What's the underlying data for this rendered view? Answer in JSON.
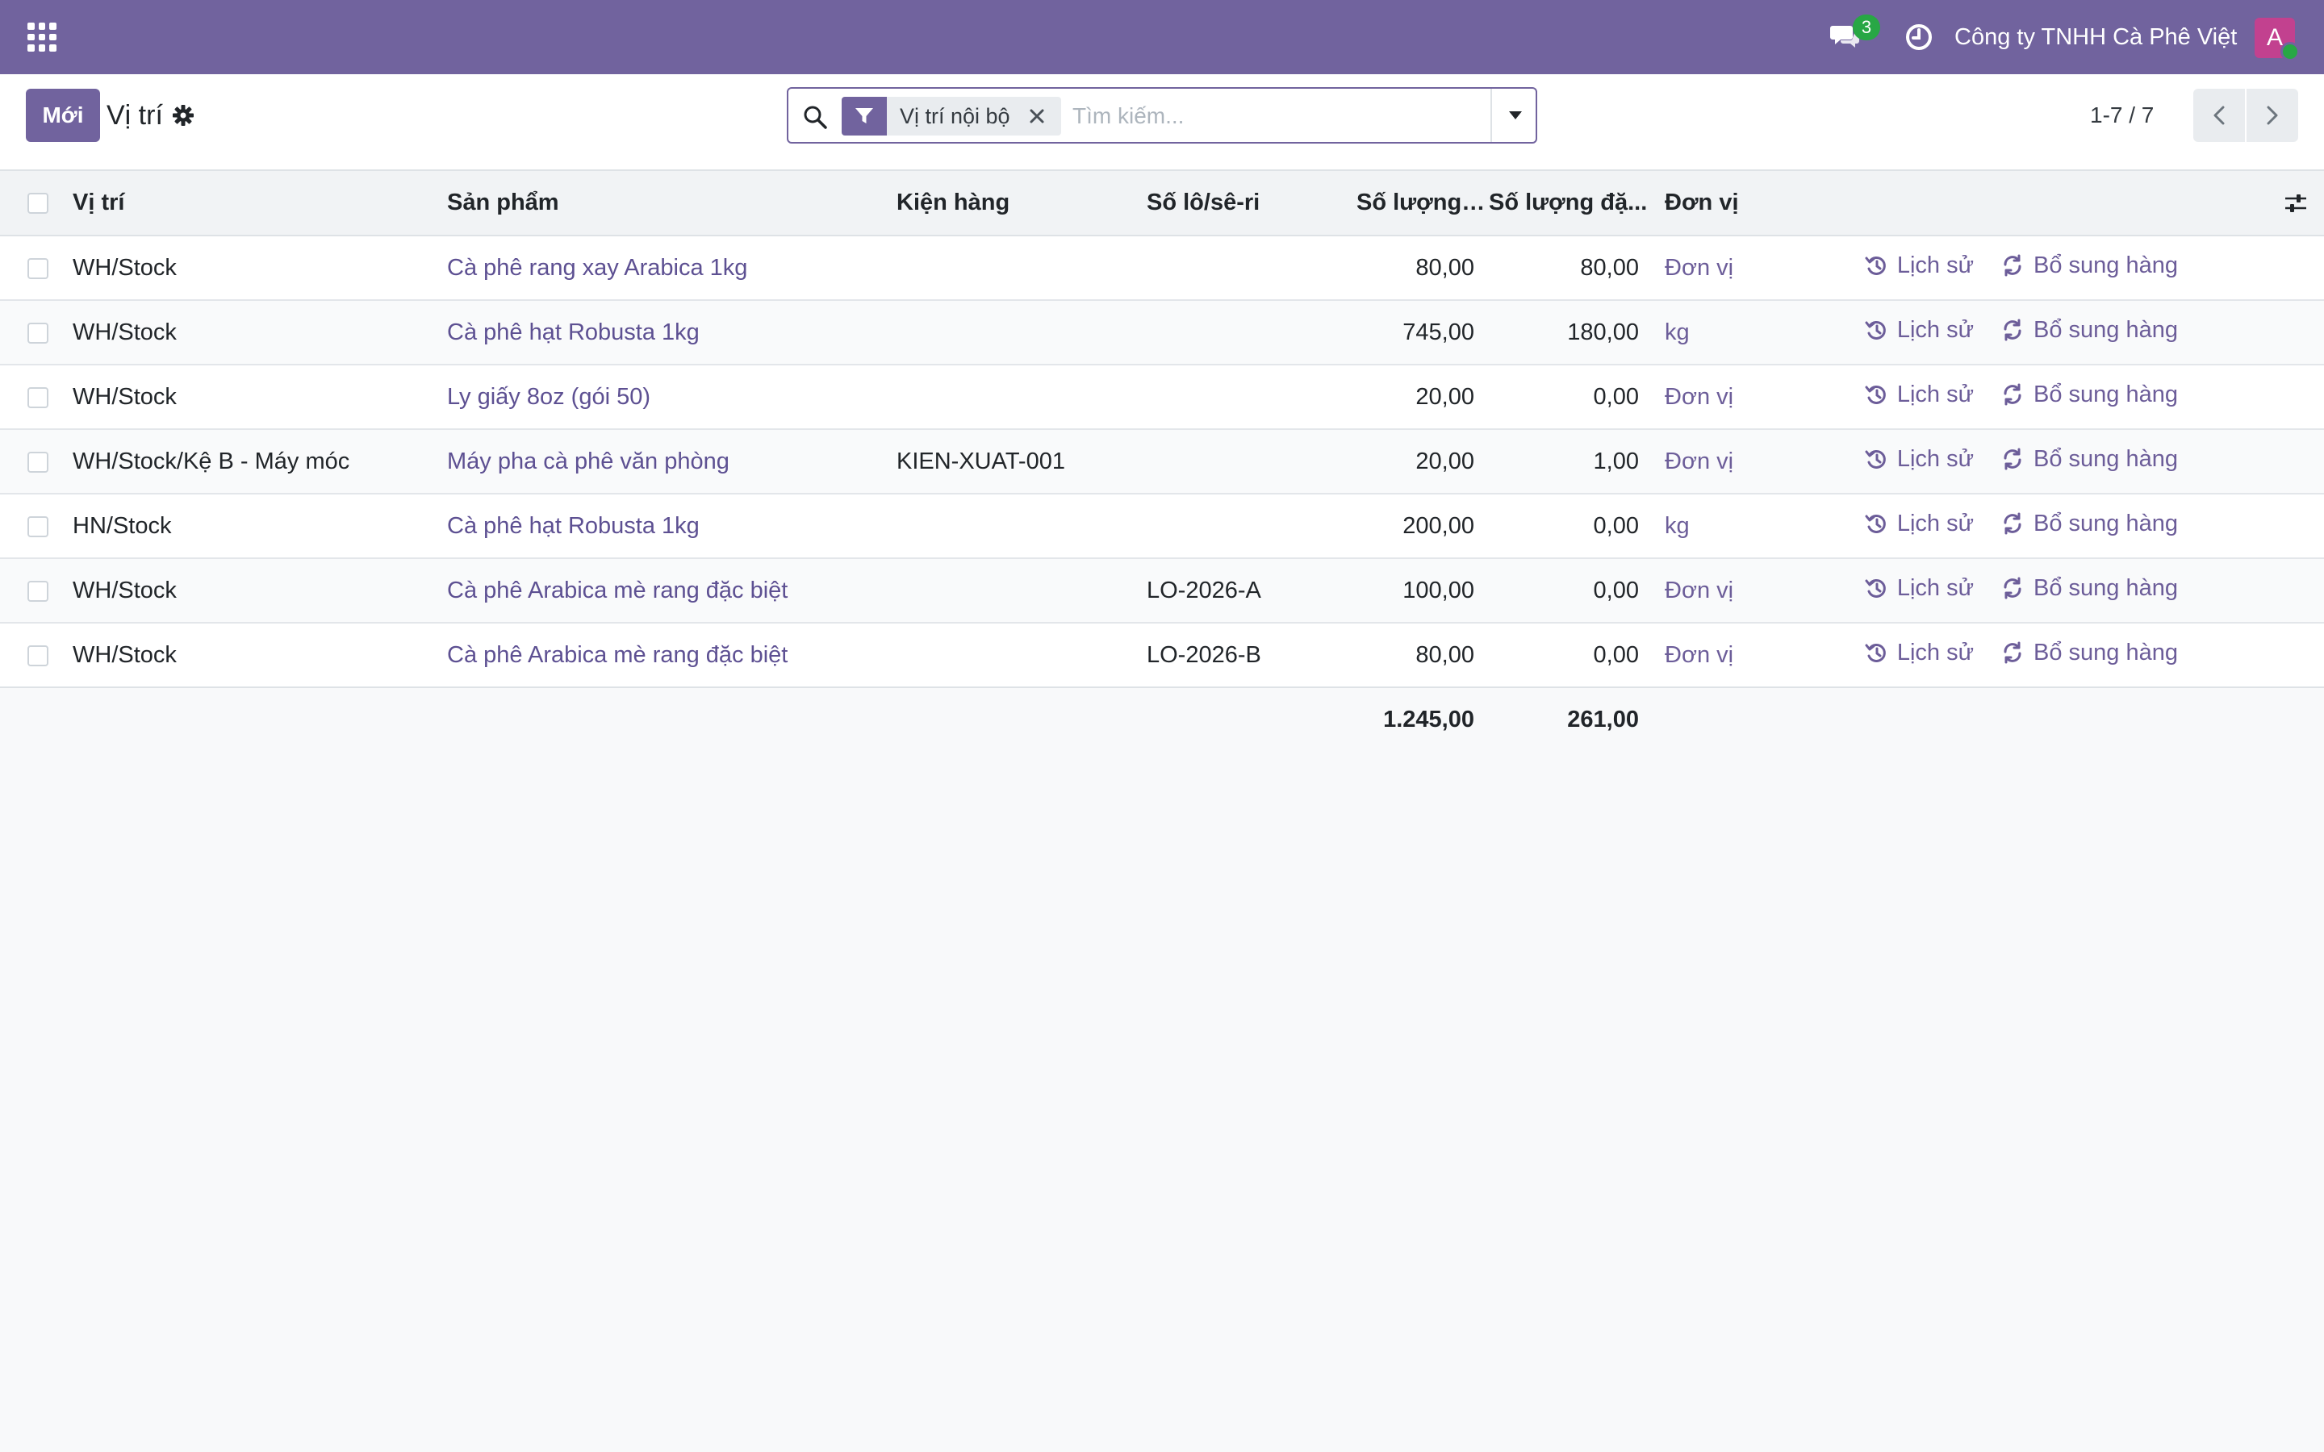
{
  "navbar": {
    "apps_icon": "apps-grid-icon",
    "chat_icon": "chat-icon",
    "chat_badge": "3",
    "activity_icon": "clock-icon",
    "company": "Công ty TNHH Cà Phê Việt",
    "avatar_initial": "A",
    "color": "#71639e"
  },
  "control_panel": {
    "new_button": "Mới",
    "title": "Vị trí",
    "settings_icon": "gear-icon",
    "search": {
      "facet_icon": "filter-icon",
      "facet_label": "Vị trí nội bộ",
      "placeholder": "Tìm kiếm...",
      "value": ""
    },
    "pager": {
      "value": "1-7 / 7",
      "prev_icon": "chevron-left-icon",
      "next_icon": "chevron-right-icon"
    }
  },
  "table": {
    "headers": {
      "location": "Vị trí",
      "product": "Sản phẩm",
      "package": "Kiện hàng",
      "lot": "Số lô/sê-ri",
      "on_hand": "Số lượng đư...",
      "reserved": "Số lượng đặ...",
      "uom": "Đơn vị"
    },
    "rows": [
      {
        "location": "WH/Stock",
        "product": "Cà phê rang xay Arabica 1kg",
        "package": "",
        "lot": "",
        "on_hand": "80,00",
        "reserved": "80,00",
        "uom": "Đơn vị"
      },
      {
        "location": "WH/Stock",
        "product": "Cà phê hạt Robusta 1kg",
        "package": "",
        "lot": "",
        "on_hand": "745,00",
        "reserved": "180,00",
        "uom": "kg"
      },
      {
        "location": "WH/Stock",
        "product": "Ly giấy 8oz (gói 50)",
        "package": "",
        "lot": "",
        "on_hand": "20,00",
        "reserved": "0,00",
        "uom": "Đơn vị"
      },
      {
        "location": "WH/Stock/Kệ B - Máy móc",
        "product": "Máy pha cà phê văn phòng",
        "package": "KIEN-XUAT-001",
        "lot": "",
        "on_hand": "20,00",
        "reserved": "1,00",
        "uom": "Đơn vị"
      },
      {
        "location": "HN/Stock",
        "product": "Cà phê hạt Robusta 1kg",
        "package": "",
        "lot": "",
        "on_hand": "200,00",
        "reserved": "0,00",
        "uom": "kg"
      },
      {
        "location": "WH/Stock",
        "product": "Cà phê Arabica mè rang đặc biệt",
        "package": "",
        "lot": "LO-2026-A",
        "on_hand": "100,00",
        "reserved": "0,00",
        "uom": "Đơn vị"
      },
      {
        "location": "WH/Stock",
        "product": "Cà phê Arabica mè rang đặc biệt",
        "package": "",
        "lot": "LO-2026-B",
        "on_hand": "80,00",
        "reserved": "0,00",
        "uom": "Đơn vị"
      }
    ],
    "actions": {
      "history_label": "Lịch sử",
      "history_icon": "history-icon",
      "replenish_label": "Bổ sung hàng",
      "replenish_icon": "refresh-icon"
    },
    "totals": {
      "on_hand": "1.245,00",
      "reserved": "261,00"
    },
    "optional_columns_icon": "sliders-icon"
  }
}
